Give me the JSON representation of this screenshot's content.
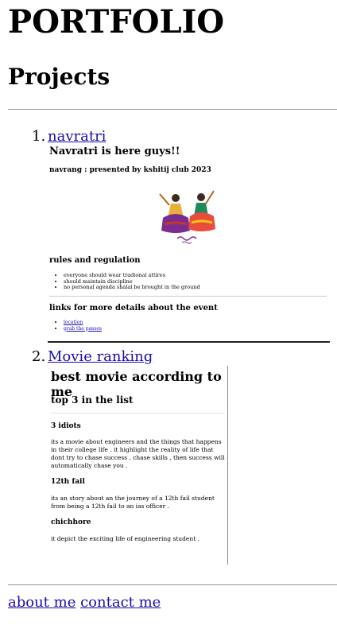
{
  "page": {
    "title": "PORTFOLIO",
    "section_heading": "Projects"
  },
  "projects": [
    {
      "number": "1.",
      "link": "navratri",
      "heading": "Navratri is here guys!!",
      "subheading": "navrang : presented by kshitij club 2023",
      "rules_heading": "rules and regulation",
      "rules": [
        "everyone should wear tradional attires",
        "should maintain discipline",
        "no personal agenda shalal be brought in the ground"
      ],
      "links_heading": "links for more details about the event",
      "links": [
        "location",
        "grab the passes"
      ]
    },
    {
      "number": "2.",
      "link": "Movie ranking",
      "heading": "best movie according to me",
      "subheading": "top 3 in the list",
      "movies": [
        {
          "title": "3 idiots",
          "desc": "its a movie about engineers and the things that happens in their college life . it highlight the reality of life that dont try to chase success , chase skills , then success will automatically chase you ."
        },
        {
          "title": "12th fail",
          "desc": "its an story about an the journey of a 12th fail student from being a 12th fail to an ias officer ."
        },
        {
          "title": "chichhore",
          "desc": "it depict the exciting life of engineering student ."
        }
      ]
    }
  ],
  "footer": {
    "about": "about me",
    "contact": "contact me"
  }
}
